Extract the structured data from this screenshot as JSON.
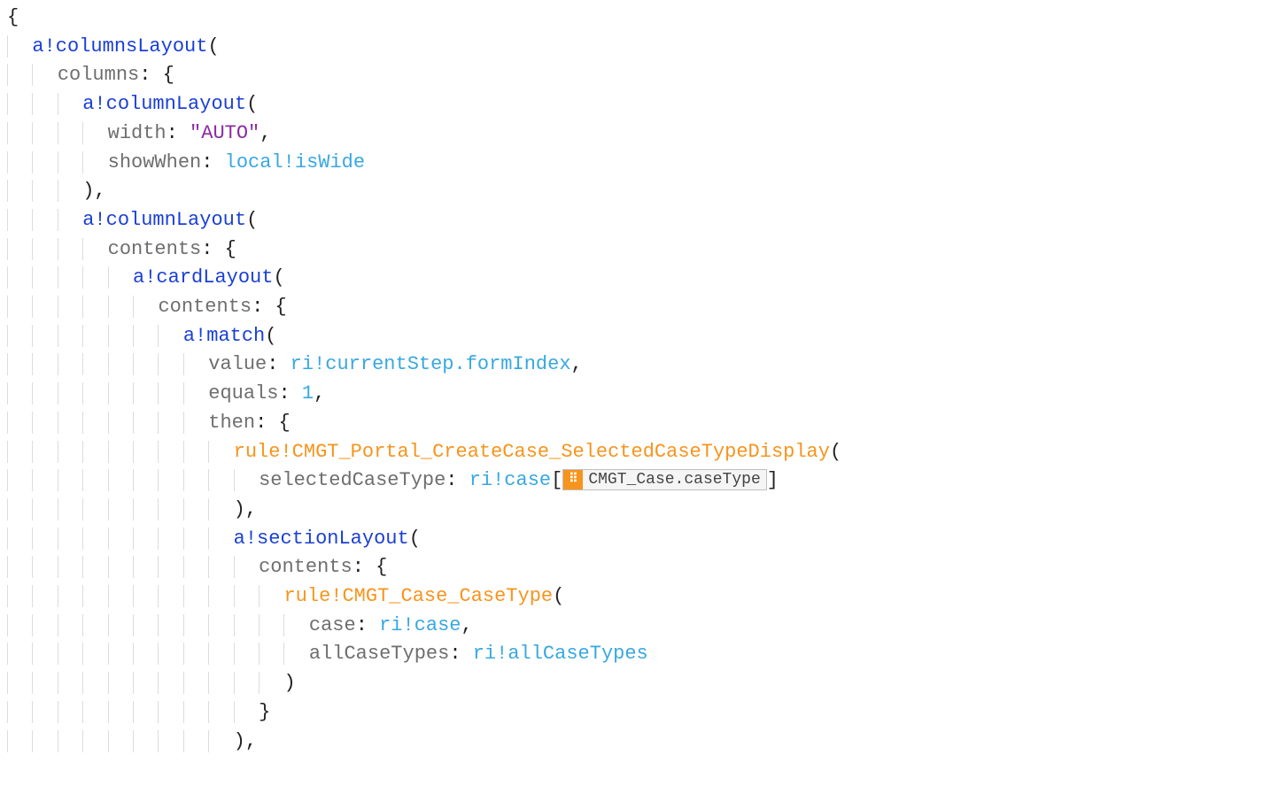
{
  "line1": {
    "brace": "{"
  },
  "line2": {
    "fn": "a!columnsLayout",
    "open": "("
  },
  "line3": {
    "param": "columns",
    "colon": ":",
    "brace": " {"
  },
  "line4": {
    "fn": "a!columnLayout",
    "open": "("
  },
  "line5": {
    "param": "width",
    "colon": ":",
    "str": " \"AUTO\"",
    "comma": ","
  },
  "line6": {
    "param": "showWhen",
    "colon": ":",
    "var": " local!isWide"
  },
  "line7": {
    "close": ")",
    "comma": ","
  },
  "line8": {
    "fn": "a!columnLayout",
    "open": "("
  },
  "line9": {
    "param": "contents",
    "colon": ":",
    "brace": " {"
  },
  "line10": {
    "fn": "a!cardLayout",
    "open": "("
  },
  "line11": {
    "param": "contents",
    "colon": ":",
    "brace": " {"
  },
  "line12": {
    "fn": "a!match",
    "open": "("
  },
  "line13": {
    "param": "value",
    "colon": ":",
    "var": " ri!currentStep.formIndex",
    "comma": ","
  },
  "line14": {
    "param": "equals",
    "colon": ":",
    "num": " 1",
    "comma": ","
  },
  "line15": {
    "param": "then",
    "colon": ":",
    "brace": " {"
  },
  "line16": {
    "rule": "rule!CMGT_Portal_CreateCase_SelectedCaseTypeDisplay",
    "open": "("
  },
  "line17": {
    "param": "selectedCaseType",
    "colon": ":",
    "var": " ri!case",
    "bracket_open": "[",
    "chip": "CMGT_Case.caseType",
    "bracket_close": "]"
  },
  "line18": {
    "close": ")",
    "comma": ","
  },
  "line19": {
    "fn": "a!sectionLayout",
    "open": "("
  },
  "line20": {
    "param": "contents",
    "colon": ":",
    "brace": " {"
  },
  "line21": {
    "rule": "rule!CMGT_Case_CaseType",
    "open": "("
  },
  "line22": {
    "param": "case",
    "colon": ":",
    "var": " ri!case",
    "comma": ","
  },
  "line23": {
    "param": "allCaseTypes",
    "colon": ":",
    "var": " ri!allCaseTypes"
  },
  "line24": {
    "close": ")"
  },
  "line25": {
    "brace": "}"
  },
  "line26": {
    "close": ")",
    "comma": ","
  }
}
